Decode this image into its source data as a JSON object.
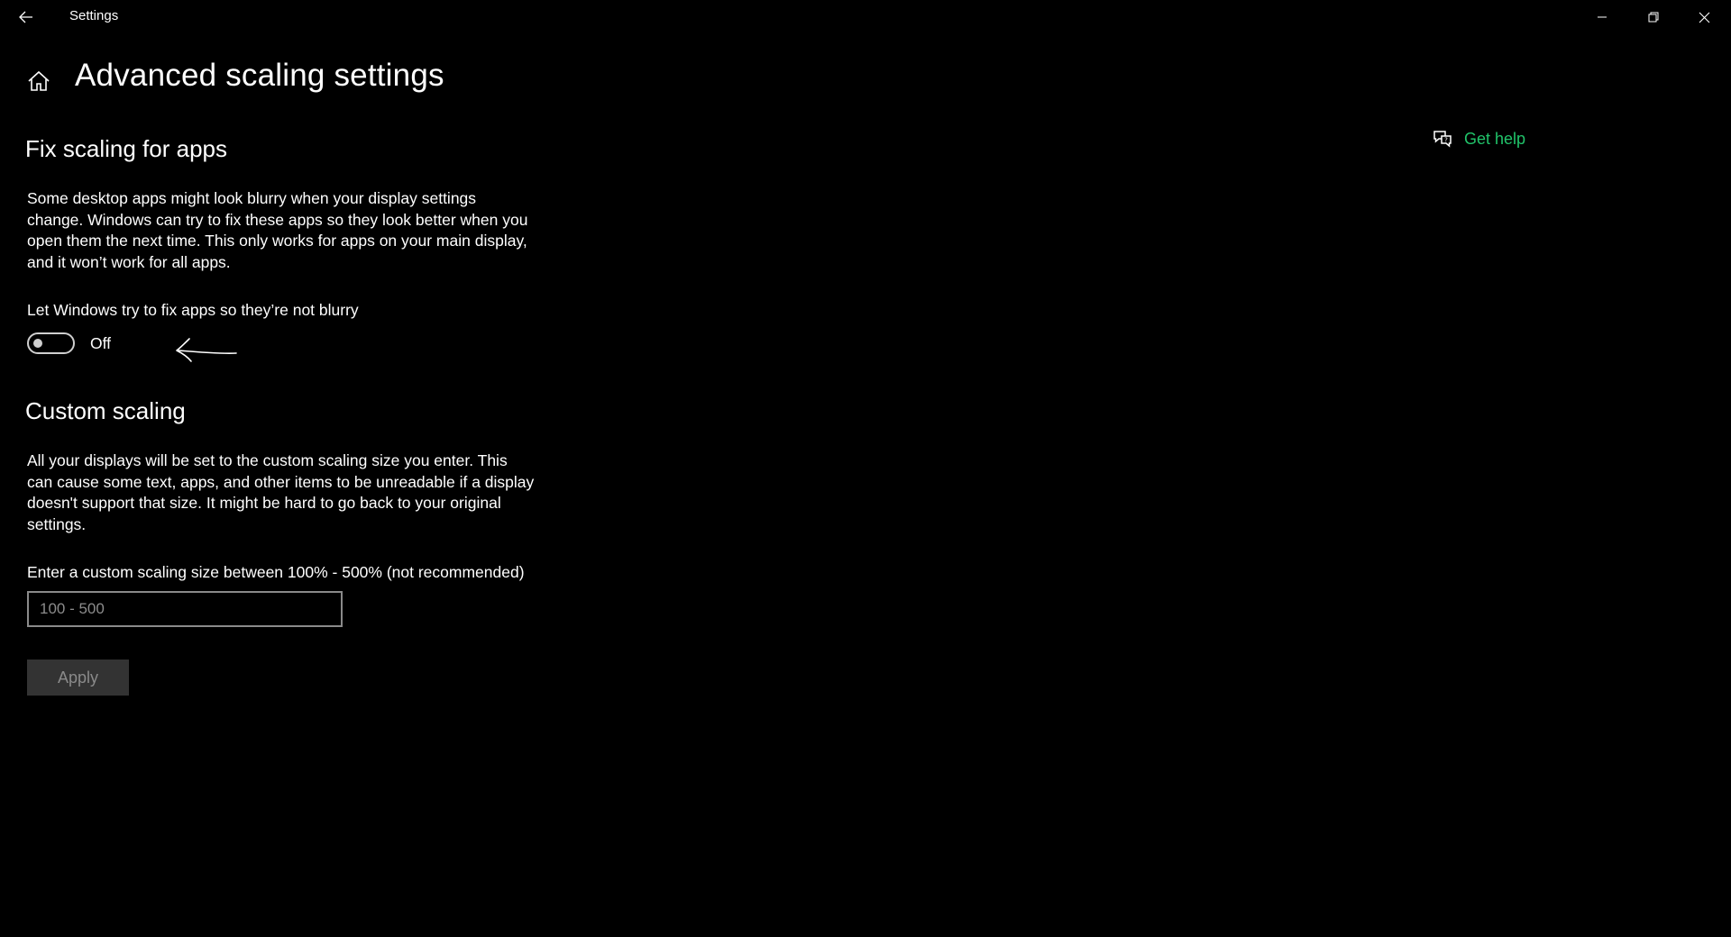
{
  "window": {
    "title": "Settings",
    "controls": {
      "back": "back-arrow-icon",
      "minimize": "minimize-icon",
      "restore": "restore-icon",
      "close": "close-icon"
    }
  },
  "header": {
    "home_icon": "home-icon",
    "title": "Advanced scaling settings"
  },
  "help": {
    "icon": "chat-help-icon",
    "label": "Get help",
    "color": "#21c46a"
  },
  "fix_scaling": {
    "title": "Fix scaling for apps",
    "description": "Some desktop apps might look blurry when your display settings change. Windows can try to fix these apps so they look better when you open them the next time. This only works for apps on your main display, and it won’t work for all apps.",
    "toggle_label": "Let Windows try to fix apps so they’re not blurry",
    "toggle_on": false,
    "toggle_state_text": "Off",
    "annotation": "hand-drawn-arrow-icon"
  },
  "custom_scaling": {
    "title": "Custom scaling",
    "description": "All your displays will be set to the custom scaling size you enter. This can cause some text, apps, and other items to be unreadable if a display doesn't support that size. It might be hard to go back to your original settings.",
    "input_label": "Enter a custom scaling size between 100% - 500% (not recommended)",
    "input_value": "",
    "input_placeholder": "100 - 500",
    "apply_label": "Apply",
    "apply_enabled": false
  },
  "colors": {
    "background": "#000000",
    "text": "#ffffff",
    "accent": "#21c46a",
    "disabled_button": "#333333",
    "disabled_text": "#8a8a8a"
  }
}
